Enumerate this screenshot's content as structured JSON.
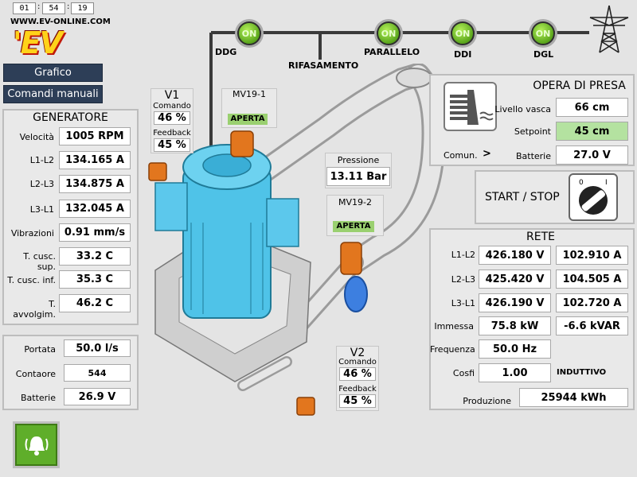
{
  "clock": {
    "h": "01",
    "m": "54",
    "s": "19",
    "sep": ":"
  },
  "brand": {
    "url": "WWW.EV-ONLINE.COM",
    "logo": "'EV"
  },
  "nav": {
    "grafico": "Grafico",
    "comandi": "Comandi manuali"
  },
  "bus": {
    "labels": {
      "ddg": "DDG",
      "rifasamento": "RIFASAMENTO",
      "parallelo": "PARALLELO",
      "ddi": "DDI",
      "dgl": "DGL"
    },
    "switches": {
      "ddg": "ON",
      "parallelo": "ON",
      "ddi": "ON",
      "dgl": "ON"
    }
  },
  "generatore": {
    "title": "GENERATORE",
    "rows": [
      {
        "label": "Velocità",
        "value": "1005 RPM"
      },
      {
        "label": "L1-L2",
        "value": "134.165 A"
      },
      {
        "label": "L2-L3",
        "value": "134.875 A"
      },
      {
        "label": "L3-L1",
        "value": "132.045 A"
      },
      {
        "label": "Vibrazioni",
        "value": "0.91 mm/s"
      },
      {
        "label": "T. cusc. sup.",
        "value": "33.2 C"
      },
      {
        "label": "T. cusc. inf.",
        "value": "35.3 C"
      },
      {
        "label": "T. avvolgim.",
        "value": "46.2 C"
      }
    ]
  },
  "flow": {
    "rows": [
      {
        "label": "Portata",
        "value": "50.0 l/s"
      },
      {
        "label": "Contaore",
        "value": "544"
      },
      {
        "label": "Batterie",
        "value": "26.9 V"
      }
    ]
  },
  "v1": {
    "title": "V1",
    "comando_label": "Comando",
    "comando": "46 %",
    "feedback_label": "Feedback",
    "feedback": "45 %"
  },
  "v2": {
    "title": "V2",
    "comando_label": "Comando",
    "comando": "46 %",
    "feedback_label": "Feedback",
    "feedback": "45 %"
  },
  "mv19_1": {
    "title": "MV19-1",
    "status": "APERTA"
  },
  "mv19_2": {
    "title": "MV19-2",
    "status": "APERTA"
  },
  "pressione": {
    "label": "Pressione",
    "value": "13.11 Bar"
  },
  "presa": {
    "title": "OPERA DI PRESA",
    "livello_label": "Livello vasca",
    "livello": "66 cm",
    "setpoint_label": "Setpoint",
    "setpoint": "45 cm",
    "comun_label": "Comun.",
    "comun_arrow": ">",
    "batterie_label": "Batterie",
    "batterie": "27.0 V"
  },
  "startstop": {
    "label": "START / STOP",
    "marks": {
      "off": "0",
      "on": "I"
    }
  },
  "rete": {
    "title": "RETE",
    "phases": [
      {
        "label": "L1-L2",
        "v": "426.180 V",
        "a": "102.910 A"
      },
      {
        "label": "L2-L3",
        "v": "425.420 V",
        "a": "104.505 A"
      },
      {
        "label": "L3-L1",
        "v": "426.190 V",
        "a": "102.720 A"
      }
    ],
    "immessa_label": "Immessa",
    "immessa_kw": "75.8 kW",
    "immessa_kvar": "-6.6 kVAR",
    "frequenza_label": "Frequenza",
    "frequenza": "50.0 Hz",
    "cosfi_label": "Cosfi",
    "cosfi": "1.00",
    "cosfi_type": "INDUTTIVO",
    "produzione_label": "Produzione",
    "produzione": "25944 kWh"
  },
  "colors": {
    "on_green": "#6bbf2a",
    "status_green": "#9ad070",
    "nav": "#2d3e57",
    "setpoint_bg": "#b4e2a0",
    "turbine": "#4fc3e8",
    "actuator": "#e2761e"
  },
  "icons": {
    "alarm": "alarm-bell-icon",
    "pylon": "power-pylon-icon",
    "dam": "dam-icon",
    "switch": "rotary-switch-icon"
  }
}
